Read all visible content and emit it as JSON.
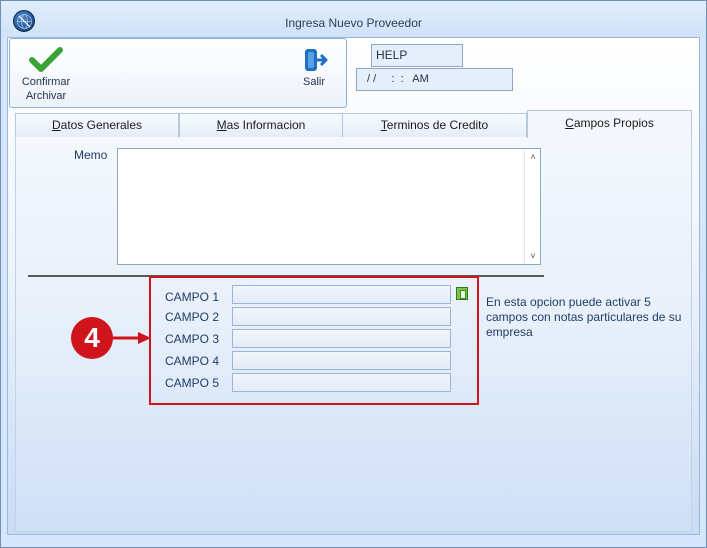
{
  "window": {
    "title": "Ingresa Nuevo Proveedor"
  },
  "toolbar": {
    "confirm": {
      "line1": "Confirmar",
      "line2": "Archivar",
      "icon": "checkmark-icon"
    },
    "exit": {
      "label": "Salir",
      "icon": "exit-door-icon"
    }
  },
  "status": {
    "help": "HELP",
    "datetime": "/ /     :  :   AM"
  },
  "tabs": [
    {
      "label": "Datos Generales",
      "underline": "D",
      "rest": "atos Generales"
    },
    {
      "label": "Mas Informacion",
      "underline": "M",
      "rest": "as Informacion"
    },
    {
      "label": "Terminos de Credito",
      "underline": "T",
      "rest": "erminos de Credito"
    },
    {
      "label": "Campos Propios",
      "underline": "C",
      "rest": "ampos Propios",
      "active": true
    }
  ],
  "memo": {
    "label": "Memo",
    "value": ""
  },
  "campos": [
    {
      "label": "CAMPO 1",
      "value": ""
    },
    {
      "label": "CAMPO 2",
      "value": ""
    },
    {
      "label": "CAMPO 3",
      "value": ""
    },
    {
      "label": "CAMPO 4",
      "value": ""
    },
    {
      "label": "CAMPO 5",
      "value": ""
    }
  ],
  "note": "En esta opcion puede activar 5 campos con notas particulares de su empresa",
  "annotation": {
    "step": "4"
  },
  "colors": {
    "accent_red": "#d0141b",
    "label_blue": "#1f3d66",
    "check_green": "#3aa335"
  }
}
